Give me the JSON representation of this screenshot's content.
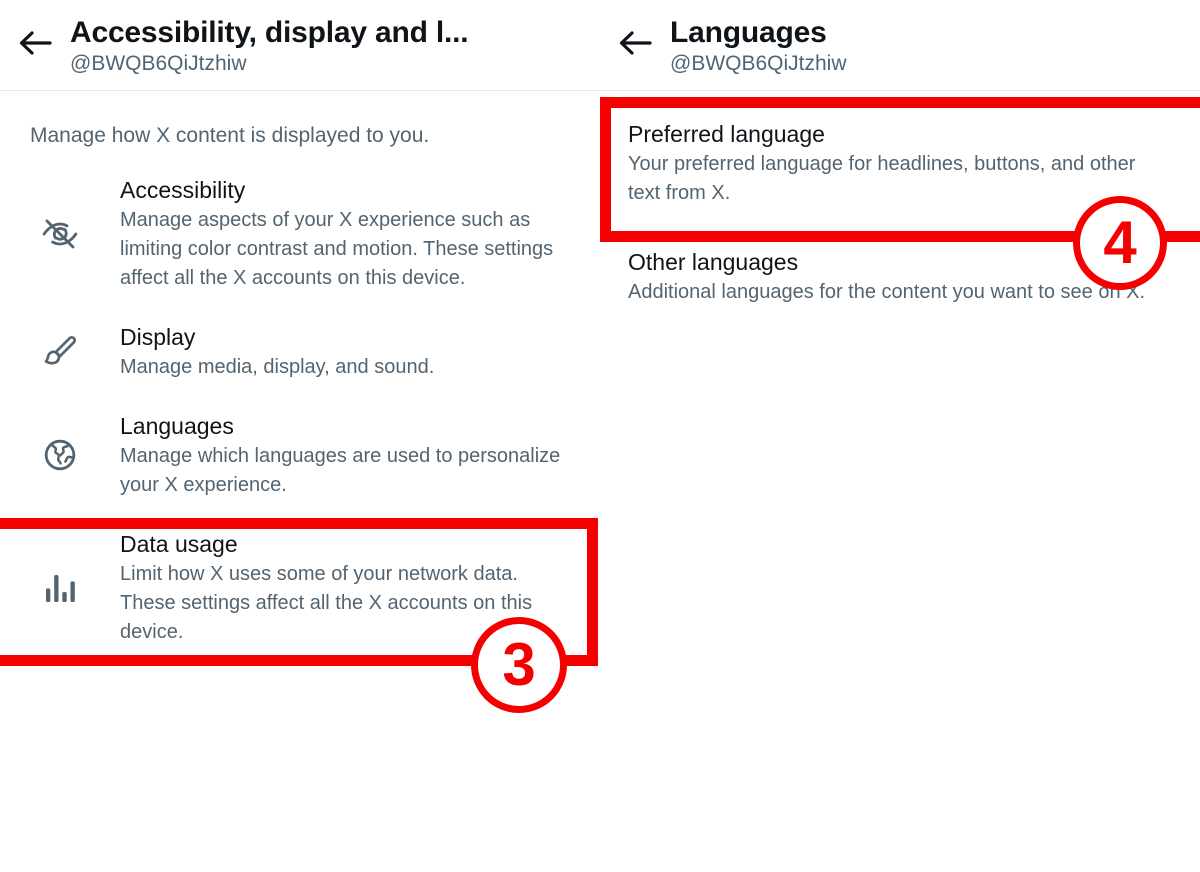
{
  "colors": {
    "annotation": "#f40000",
    "primary_text": "#0f1419",
    "secondary_text": "#536471",
    "divider": "#e6e8ea",
    "background": "#ffffff"
  },
  "left_panel": {
    "back_icon": "back-arrow-icon",
    "title": "Accessibility, display and l...",
    "handle": "@BWQB6QiJtzhiw",
    "intro": "Manage how X content is displayed to you.",
    "items": [
      {
        "icon": "eye-off-icon",
        "title": "Accessibility",
        "description": "Manage aspects of your X experience such as limiting color contrast and motion. These settings affect all the X accounts on this device."
      },
      {
        "icon": "paintbrush-icon",
        "title": "Display",
        "description": "Manage media, display, and sound."
      },
      {
        "icon": "globe-icon",
        "title": "Languages",
        "description": "Manage which languages are used to personalize your X experience."
      },
      {
        "icon": "bar-chart-icon",
        "title": "Data usage",
        "description": "Limit how X uses some of your network data. These settings affect all the X accounts on this device."
      }
    ]
  },
  "right_panel": {
    "back_icon": "back-arrow-icon",
    "title": "Languages",
    "handle": "@BWQB6QiJtzhiw",
    "items": [
      {
        "title": "Preferred language",
        "description": "Your preferred language for headlines, buttons, and other text from X."
      },
      {
        "title": "Other languages",
        "description": "Additional languages for the content you want to see on X."
      }
    ]
  },
  "annotations": {
    "step_three": "3",
    "step_four": "4"
  }
}
